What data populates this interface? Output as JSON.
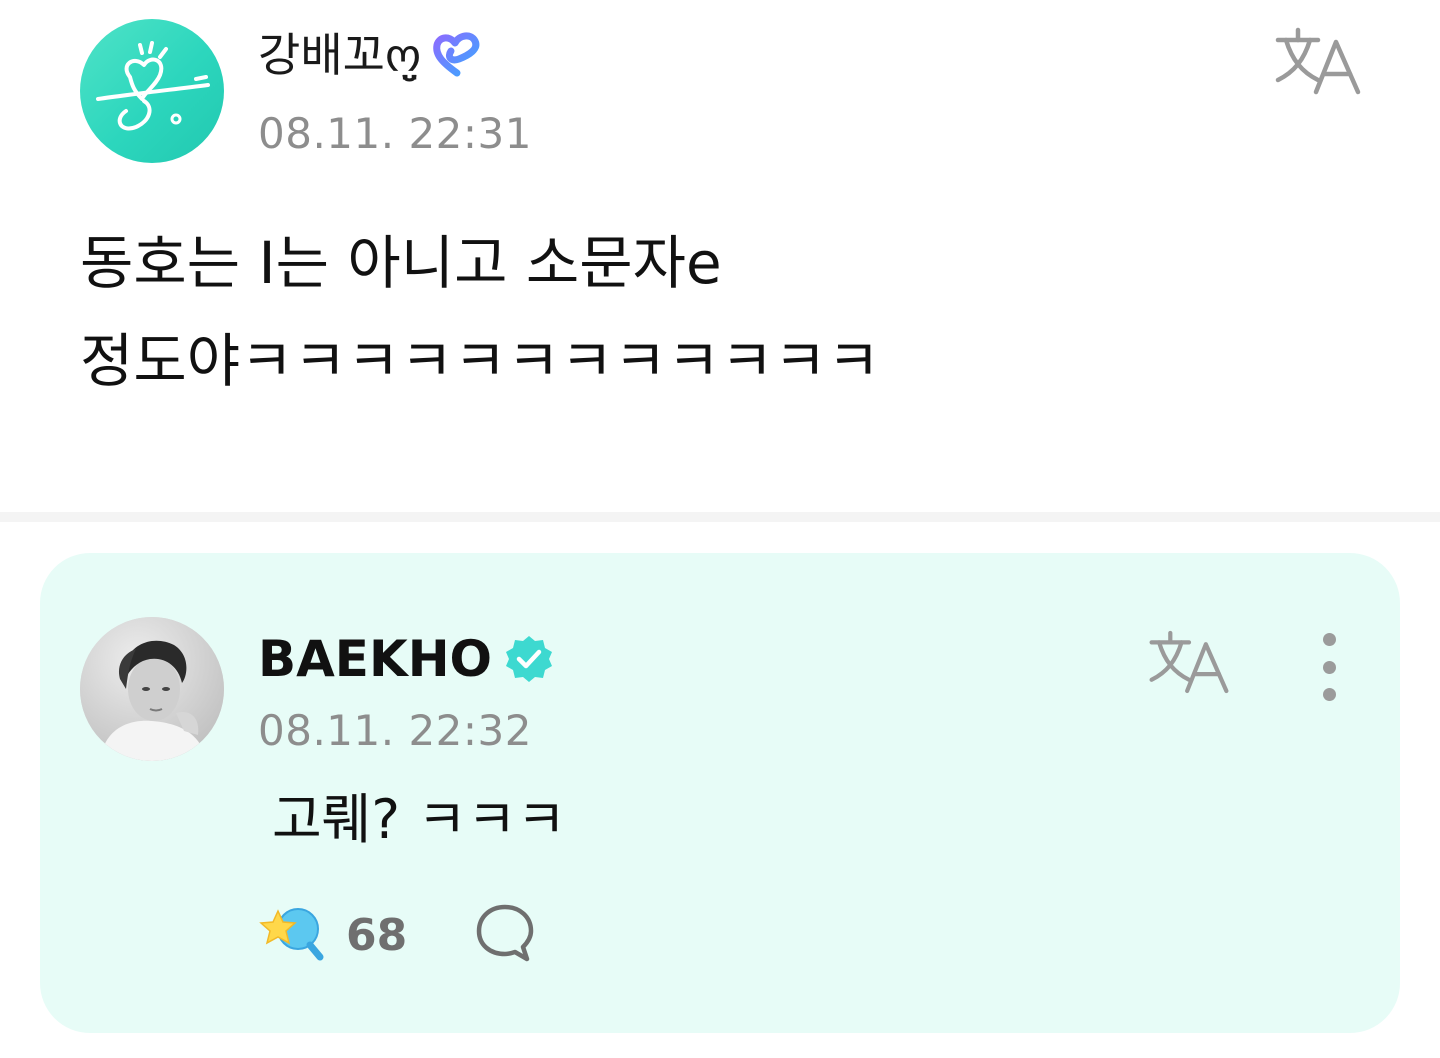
{
  "post": {
    "author": {
      "name": "강배꼬ო̤̮",
      "icon": "membership-heart-icon"
    },
    "time": "08.11. 22:31",
    "translate_icon": "translate-icon",
    "body_lines": [
      "동호는 I는 아니고 소문자e",
      "정도야ㅋㅋㅋㅋㅋㅋㅋㅋㅋㅋㅋㅋ"
    ]
  },
  "reply": {
    "author": {
      "name": "BAEKHO",
      "badge": "verified-badge-icon"
    },
    "time": "08.11. 22:32",
    "text": "고뤠? ㅋㅋㅋ",
    "cheer_count": "68",
    "icons": {
      "translate": "translate-icon",
      "more": "more-vertical-icon",
      "cheer": "cheer-star-icon",
      "comment": "comment-bubble-icon"
    }
  },
  "colors": {
    "accent": "#2cd6bd",
    "reply_background": "#e7fcf7",
    "verified": "#3dd9d0",
    "muted_text": "#8d8d8d"
  }
}
